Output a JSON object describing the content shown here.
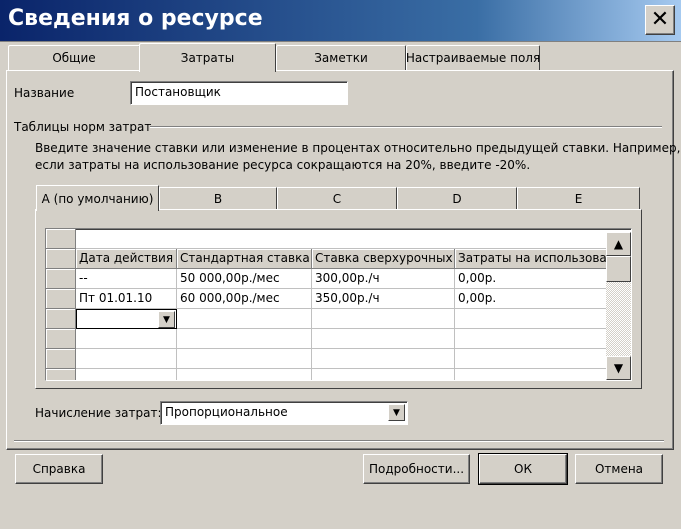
{
  "window": {
    "title": "Сведения о ресурсе",
    "close_glyph": "✕"
  },
  "tabs": [
    {
      "label": "Общие"
    },
    {
      "label": "Затраты"
    },
    {
      "label": "Заметки"
    },
    {
      "label": "Настраиваемые поля"
    }
  ],
  "name_field": {
    "label": "Название",
    "value": "Постановщик"
  },
  "rates_group": {
    "title": "Таблицы норм затрат",
    "hint_line1": "Введите значение ставки или изменение в процентах относительно предыдущей ставки. Например,",
    "hint_line2": "если затраты на использование ресурса сокращаются на 20%, введите -20%."
  },
  "rate_tabs": [
    {
      "label": "A (по умолчанию)"
    },
    {
      "label": "B"
    },
    {
      "label": "C"
    },
    {
      "label": "D"
    },
    {
      "label": "E"
    }
  ],
  "grid": {
    "columns": [
      "Дата действия",
      "Стандартная ставка",
      "Ставка сверхурочных",
      "Затраты на использование"
    ],
    "rows": [
      [
        "--",
        "50 000,00р./мес",
        "300,00р./ч",
        "0,00р."
      ],
      [
        "Пт 01.01.10",
        "60 000,00р./мес",
        "350,00р./ч",
        "0,00р."
      ]
    ]
  },
  "accrual": {
    "label": "Начисление затрат:",
    "value": "Пропорциональное"
  },
  "buttons": {
    "help": "Справка",
    "details": "Подробности...",
    "ok": "ОК",
    "cancel": "Отмена"
  },
  "icons": {
    "close": "close-icon",
    "dropdown": "chevron-down-icon",
    "scroll_up": "arrow-up-icon",
    "scroll_down": "arrow-down-icon"
  }
}
